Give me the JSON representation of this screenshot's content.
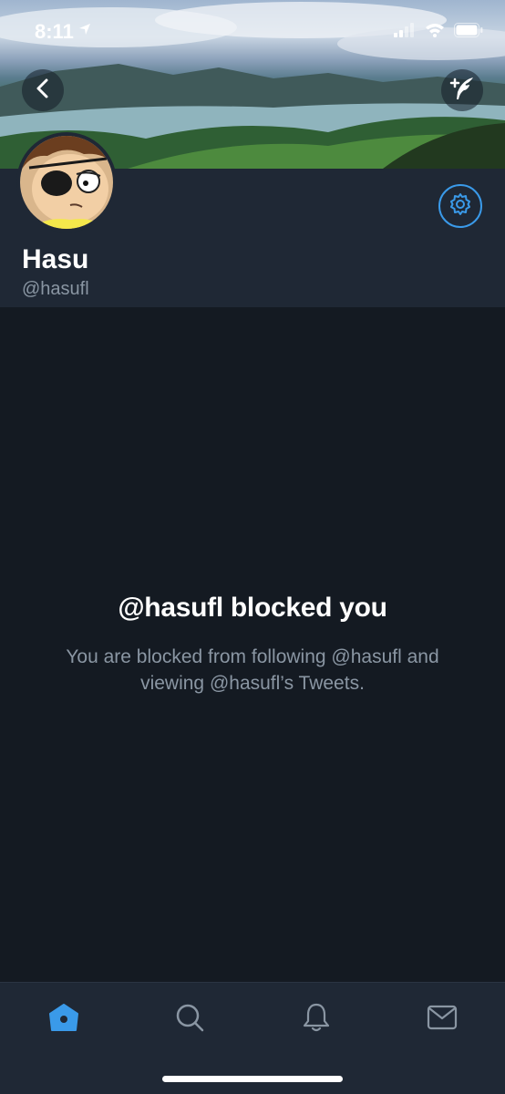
{
  "status_bar": {
    "time": "8:11",
    "icons": [
      "location-arrow-icon",
      "signal-icon",
      "wifi-icon",
      "battery-icon"
    ]
  },
  "header": {
    "back_icon": "chevron-left-icon",
    "compose_icon": "compose-tweet-icon",
    "settings_icon": "gear-icon"
  },
  "profile": {
    "display_name": "Hasu",
    "handle": "@hasufl"
  },
  "blocked": {
    "title": "@hasufl blocked you",
    "description": "You are blocked from following @hasufl and viewing @hasufl’s Tweets."
  },
  "tab_bar": {
    "tabs": [
      {
        "name": "home",
        "icon": "home-icon",
        "active": true
      },
      {
        "name": "search",
        "icon": "search-icon",
        "active": false
      },
      {
        "name": "notifications",
        "icon": "bell-icon",
        "active": false
      },
      {
        "name": "messages",
        "icon": "envelope-icon",
        "active": false
      }
    ]
  },
  "colors": {
    "background": "#141a22",
    "header_bg": "#1f2835",
    "accent": "#3a9ae9",
    "secondary_text": "#8a96a3"
  }
}
